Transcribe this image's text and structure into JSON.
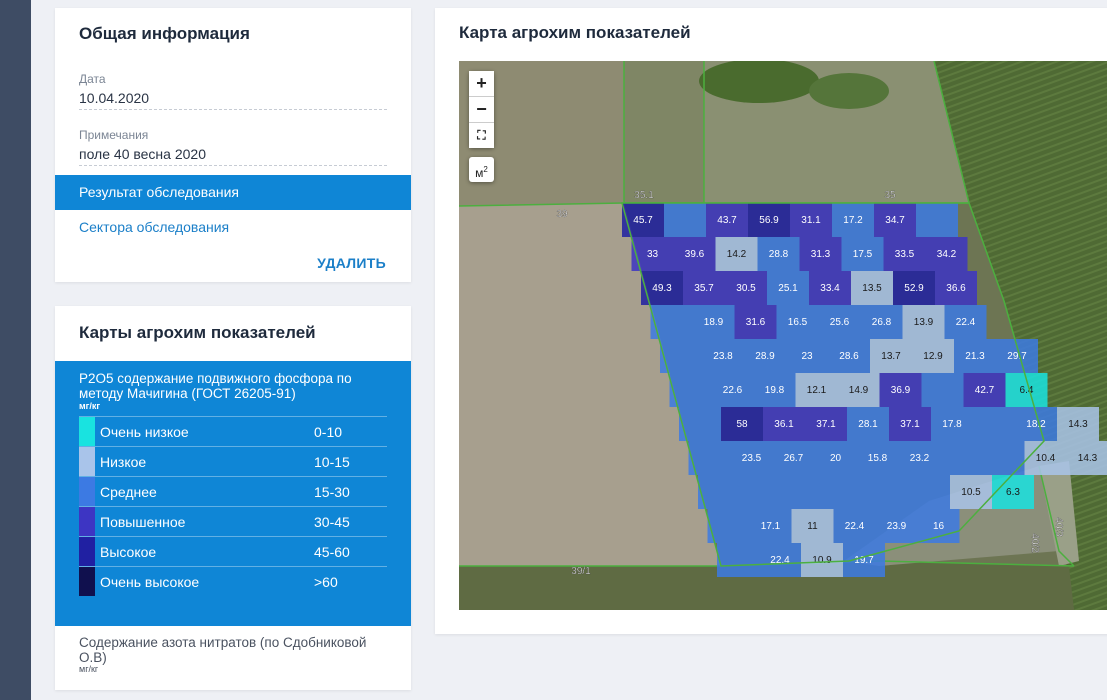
{
  "info": {
    "title": "Общая информация",
    "date_label": "Дата",
    "date_value": "10.04.2020",
    "notes_label": "Примечания",
    "notes_value": "поле 40 весна 2020",
    "result_tab": "Результат обследования",
    "sectors_link": "Сектора обследования",
    "delete_button": "УДАЛИТЬ"
  },
  "maps": {
    "title": "Карты агрохим показателей",
    "phosphorus_title": "P2O5 содержание подвижного фосфора по методу Мачигина (ГОСТ 26205-91)",
    "unit": "мг/кг",
    "legend": [
      {
        "name": "Очень низкое",
        "range": "0-10",
        "color": "#19e3e0"
      },
      {
        "name": "Низкое",
        "range": "10-15",
        "color": "#a9c4ea"
      },
      {
        "name": "Среднее",
        "range": "15-30",
        "color": "#3c7ae3"
      },
      {
        "name": "Повышенное",
        "range": "30-45",
        "color": "#3d35c3"
      },
      {
        "name": "Высокое",
        "range": "45-60",
        "color": "#2020a2"
      },
      {
        "name": "Очень высокое",
        "range": ">60",
        "color": "#10104e"
      }
    ],
    "nitrate_title": "Содержание азота нитратов (по Сдобниковой О.В)",
    "nitrate_unit": "мг/кг"
  },
  "map": {
    "title": "Карта агрохим показателей",
    "zoom_in": "+",
    "zoom_out": "−",
    "fullscreen": "⛶",
    "measure_label": "м",
    "measure_sup": "2",
    "field_labels": [
      "35.1",
      "35",
      "39",
      "39/1",
      "40/2",
      "40/3"
    ],
    "grid": [
      [
        "45.7",
        "",
        "43.7",
        "56.9",
        "31.1",
        "17.2",
        "34.7",
        ""
      ],
      [
        "33",
        "39.6",
        "14.2",
        "28.8",
        "31.3",
        "17.5",
        "33.5",
        "34.2"
      ],
      [
        "49.3",
        "35.7",
        "30.5",
        "25.1",
        "33.4",
        "13.5",
        "52.9",
        "36.6"
      ],
      [
        "",
        "18.9",
        "31.6",
        "16.5",
        "25.6",
        "26.8",
        "13.9",
        "22.4"
      ],
      [
        "",
        "23.8",
        "28.9",
        "23",
        "28.6",
        "13.7",
        "12.9",
        "21.3",
        "29.7"
      ],
      [
        "",
        "22.6",
        "19.8",
        "12.1",
        "14.9",
        "36.9",
        "",
        "42.7",
        "6.4"
      ],
      [
        "",
        "58",
        "36.1",
        "37.1",
        "28.1",
        "37.1",
        "17.8",
        "",
        "18.2",
        "14.3"
      ],
      [
        "",
        "23.5",
        "26.7",
        "20",
        "15.8",
        "23.2",
        "",
        "",
        "10.4",
        "14.3"
      ],
      [
        "",
        "",
        "",
        "",
        "",
        "",
        "10.5",
        "6.3"
      ],
      [
        "",
        "17.1",
        "11",
        "22.4",
        "23.9",
        "16"
      ],
      [
        "",
        "22.4",
        "10.9",
        "19.7"
      ]
    ]
  }
}
